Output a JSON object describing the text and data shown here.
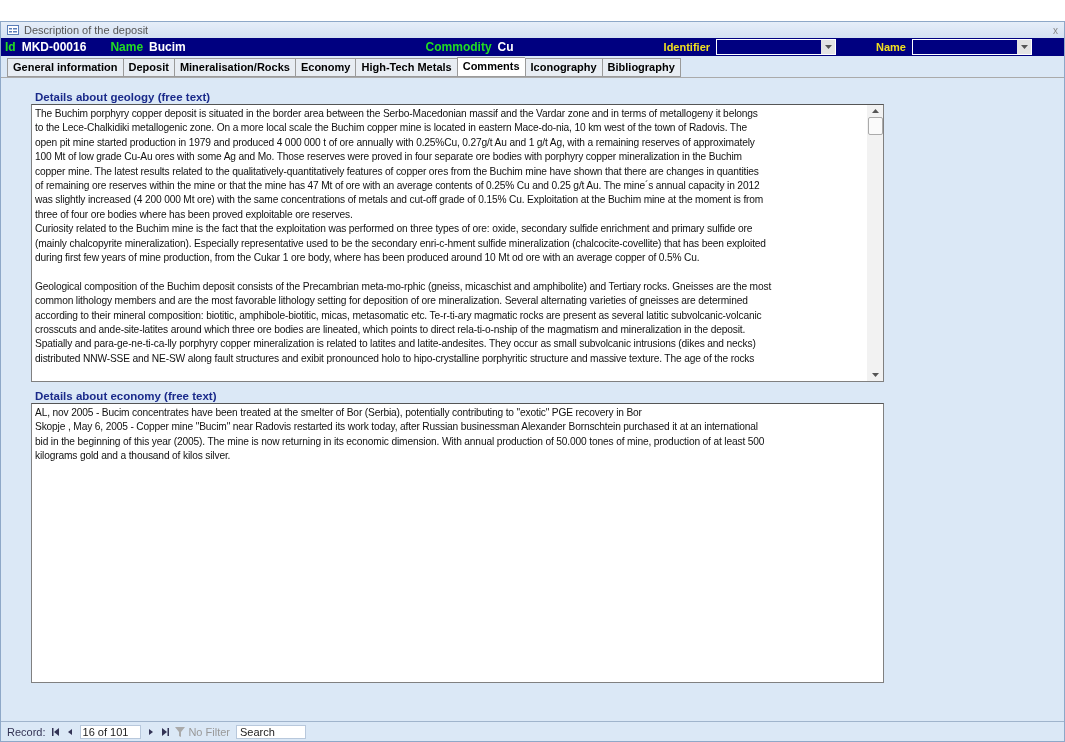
{
  "window": {
    "title": "Description of the deposit",
    "close": "x"
  },
  "header": {
    "id_label": "Id",
    "id_value": "MKD-00016",
    "name_label": "Name",
    "name_value": "Bucim",
    "commodity_label": "Commodity",
    "commodity_value": "Cu",
    "identifier_label": "Identifier",
    "search_name_label": "Name"
  },
  "tabs": [
    {
      "label": "General information",
      "selected": false
    },
    {
      "label": "Deposit",
      "selected": false
    },
    {
      "label": "Mineralisation/Rocks",
      "selected": false
    },
    {
      "label": "Economy",
      "selected": false
    },
    {
      "label": "High-Tech Metals",
      "selected": false
    },
    {
      "label": "Comments",
      "selected": true
    },
    {
      "label": "Iconography",
      "selected": false
    },
    {
      "label": "Bibliography",
      "selected": false
    }
  ],
  "geology": {
    "label": "Details about geology (free text)",
    "paragraphs": [
      [
        "The Buchim porphyry copper deposit is situated in the border area between the Serbo-Macedonian massif and the Vardar zone and in terms of metallogeny it belongs",
        "to the Lece-Chalkidiki metallogenic zone. On a more local scale the Buchim copper mine is located in eastern Mace-do-nia, 10 km west of the town of Radovis. The",
        "open pit mine started production in 1979 and produced 4 000 000 t of ore annually with 0.25%Cu, 0.27g/t Au and 1 g/t Ag, with a remaining reserves of approximately",
        "100 Mt of low grade Cu-Au ores with some Ag and Mo. Those reserves were proved in four separate ore bodies with porphyry copper mineralization in the Buchim",
        "copper mine. The latest results related to the qualitatively-quantitatively features of copper ores from the  Buchim mine have shown that there are changes in quantities",
        "of remaining ore reserves within the mine or that the mine has 47 Mt of ore with an average contents of 0.25% Cu and 0.25 g/t Au. The mine´s annual capacity in 2012",
        "was slightly increased (4 200 000 Mt ore) with the same concentrations of metals and cut-off grade of 0.15% Cu. Exploitation at the Buchim mine at the moment is from",
        "three of four ore bodies where has been proved exploitable ore reserves.",
        "Curiosity related to the Buchim mine is the fact that the exploitation was performed on three types of ore: oxide, secondary sulfide enrichment and primary sulfide ore",
        "(mainly chalcopyrite mineralization). Especially representative used to be the secondary enri-c-hment sulfide mineralization (chalcocite-covellite) that has been exploited",
        "during first few years of mine production, from the Cukar 1 ore body, where has been produced around 10 Mt od ore with an average copper of 0.5% Cu."
      ],
      [
        "Geological composition of the Buchim deposit consists of the Precambrian meta-mo-rphic (gneiss, micaschist and amphibolite) and Tertiary rocks. Gneisses are the most",
        "common lithology members and are the most favorable lithology setting for deposition of ore mineralization. Several alternating varieties of gneisses are determined",
        "according to their mineral composition: biotitic, amphibole-biotitic, micas, metasomatic etc. Te-r-ti-ary magmatic rocks are present as several latitic subvolcanic-volcanic",
        "crosscuts and ande-site-latites around which three ore bodies are lineated, which points to direct rela-ti-o-nship of the magmatism and mineralization in the deposit.",
        "Spatially and para-ge-ne-ti-ca-lly porphyry copper mineralization is related to latites and latite-andesites. They occur as small subvolcanic intrusions (dikes and necks)",
        "distributed NNW-SSE and NE-SW along fault structures and exibit pronounced holo to hipo-crystalline porphyritic structure and massive texture. The age of the rocks"
      ]
    ]
  },
  "economy": {
    "label": "Details about economy (free text)",
    "lines": [
      "AL, nov 2005 - Bucim concentrates have been treated at the smelter of Bor (Serbia), potentially contributing to \"exotic\" PGE recovery in Bor",
      "Skopje , May 6, 2005 - Copper mine \"Bucim\" near Radovis restarted its work today, after Russian businessman Alexander Bornschtein purchased it at an international",
      "bid in the beginning of this year (2005). The mine is now returning in its economic dimension. With annual production of 50.000 tones of mine, production of at least 500",
      "kilograms gold and a thousand of kilos silver."
    ]
  },
  "status_bar": {
    "record_label": "Record:",
    "position": "16 of 101",
    "filter": "No Filter",
    "search": "Search"
  }
}
